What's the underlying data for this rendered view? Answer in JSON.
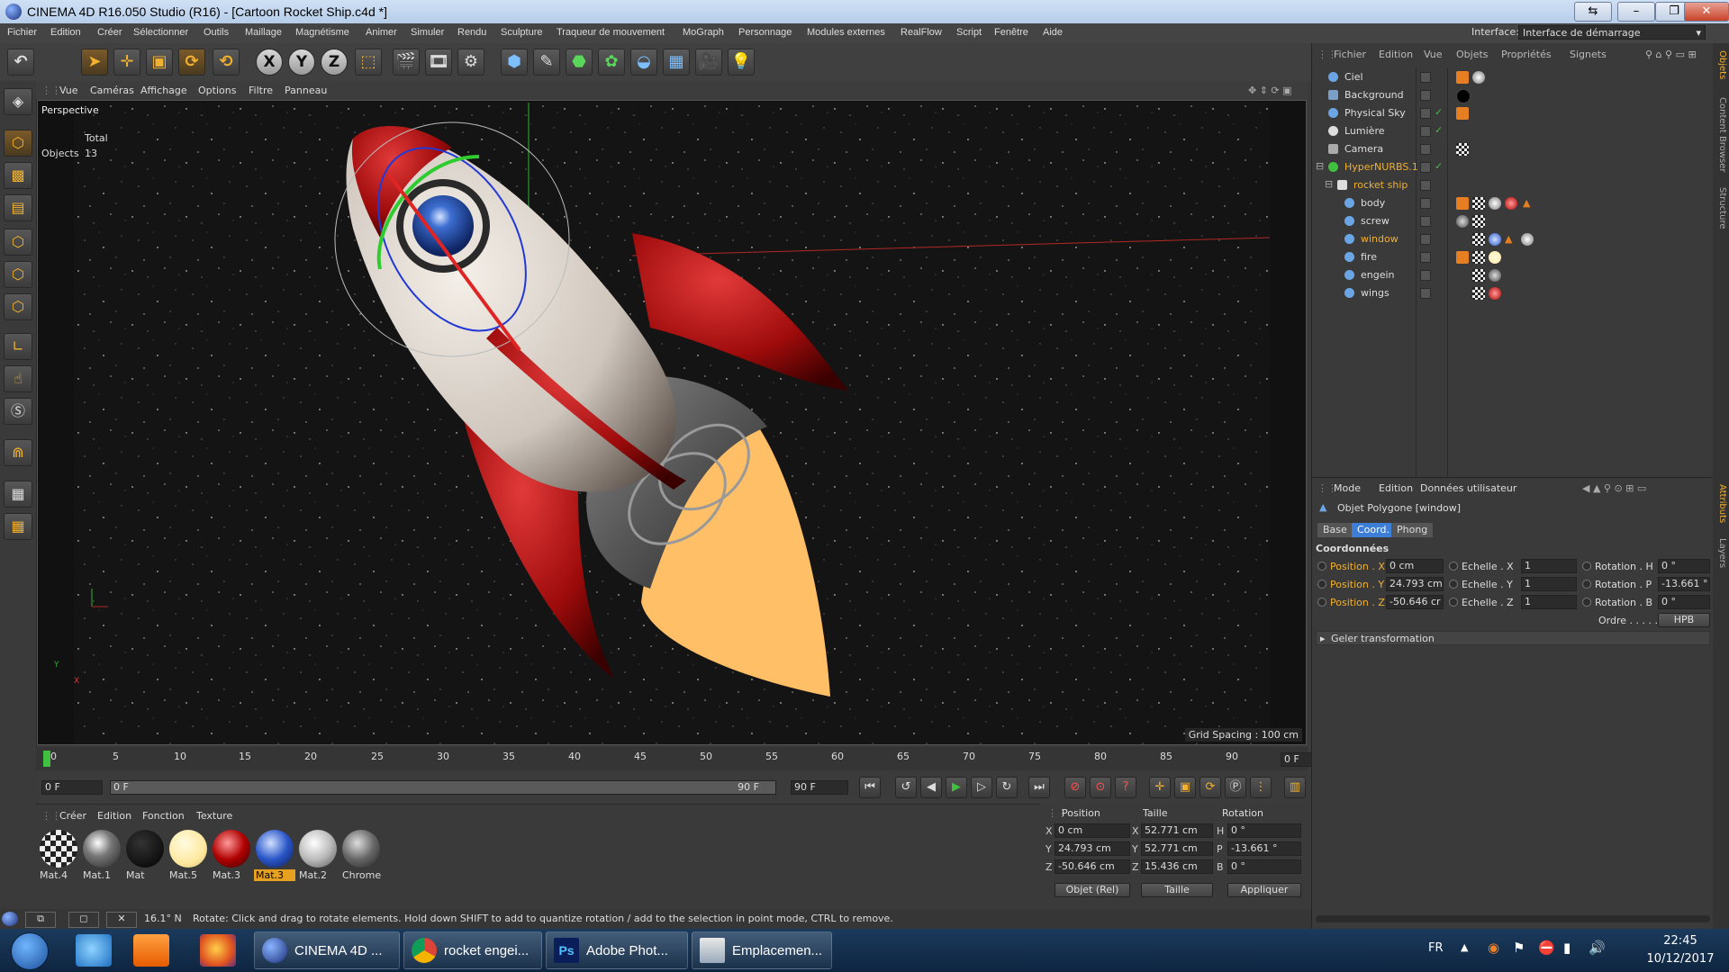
{
  "window": {
    "title": "CINEMA 4D R16.050 Studio (R16) - [Cartoon Rocket Ship.c4d *]"
  },
  "menu": [
    "Fichier",
    "Edition",
    "Créer",
    "Sélectionner",
    "Outils",
    "Maillage",
    "Magnétisme",
    "Animer",
    "Simuler",
    "Rendu",
    "Sculpture",
    "Traqueur de mouvement",
    "MoGraph",
    "Personnage",
    "Modules externes",
    "RealFlow",
    "Script",
    "Fenêtre",
    "Aide"
  ],
  "interface": {
    "label": "Interface:",
    "value": "Interface de démarrage"
  },
  "toolbar": {
    "x": "X",
    "y": "Y",
    "z": "Z"
  },
  "viewport": {
    "menu": [
      "Vue",
      "Caméras",
      "Affichage",
      "Options",
      "Filtre",
      "Panneau"
    ],
    "name": "Perspective",
    "total_label": "Total",
    "objects_label": "Objects",
    "objects_count": "13",
    "grid_spacing": "Grid Spacing : 100 cm",
    "axis_x": "X",
    "axis_y": "Y"
  },
  "timeline": {
    "ticks": [
      "0",
      "5",
      "10",
      "15",
      "20",
      "25",
      "30",
      "35",
      "40",
      "45",
      "50",
      "55",
      "60",
      "65",
      "70",
      "75",
      "80",
      "85",
      "90"
    ],
    "current_frame": "0 F",
    "start": "0 F",
    "range_start": "0 F",
    "range_end": "90 F",
    "end": "90 F"
  },
  "materials": {
    "menu": [
      "Créer",
      "Edition",
      "Fonction",
      "Texture"
    ],
    "items": [
      {
        "name": "Mat.4"
      },
      {
        "name": "Mat.1"
      },
      {
        "name": "Mat"
      },
      {
        "name": "Mat.5"
      },
      {
        "name": "Mat.3"
      },
      {
        "name": "Mat.3"
      },
      {
        "name": "Mat.2"
      },
      {
        "name": "Chrome"
      }
    ]
  },
  "coords": {
    "headers": [
      "Position",
      "Taille",
      "Rotation"
    ],
    "rows": [
      {
        "axis": "X",
        "pos": "0 cm",
        "size_axis": "X",
        "size": "52.771 cm",
        "rot_axis": "H",
        "rot": "0 °"
      },
      {
        "axis": "Y",
        "pos": "24.793 cm",
        "size_axis": "Y",
        "size": "52.771 cm",
        "rot_axis": "P",
        "rot": "-13.661 °"
      },
      {
        "axis": "Z",
        "pos": "-50.646 cm",
        "size_axis": "Z",
        "size": "15.436 cm",
        "rot_axis": "B",
        "rot": "0 °"
      }
    ],
    "mode": "Objet (Rel)",
    "size_mode": "Taille",
    "apply": "Appliquer"
  },
  "status": {
    "value": "16.1° N",
    "text": "Rotate: Click and drag to rotate elements. Hold down SHIFT to add to quantize rotation / add to the selection in point mode, CTRL to remove."
  },
  "object_manager": {
    "menu": [
      "Fichier",
      "Edition",
      "Vue",
      "Objets",
      "Propriétés",
      "Signets"
    ],
    "objects": [
      {
        "name": "Ciel",
        "level": 0
      },
      {
        "name": "Background",
        "level": 0
      },
      {
        "name": "Physical Sky",
        "level": 0
      },
      {
        "name": "Lumière",
        "level": 0
      },
      {
        "name": "Camera",
        "level": 0
      },
      {
        "name": "HyperNURBS.1",
        "level": 0
      },
      {
        "name": "rocket ship",
        "level": 1
      },
      {
        "name": "body",
        "level": 2
      },
      {
        "name": "screw",
        "level": 2
      },
      {
        "name": "window",
        "level": 2
      },
      {
        "name": "fire",
        "level": 2
      },
      {
        "name": "engein",
        "level": 2
      },
      {
        "name": "wings",
        "level": 2
      }
    ]
  },
  "attributes": {
    "menu": [
      "Mode",
      "Edition",
      "Données utilisateur"
    ],
    "object": "Objet Polygone [window]",
    "tabs": [
      "Base",
      "Coord.",
      "Phong"
    ],
    "section": "Coordonnées",
    "rows": [
      {
        "p_label": "Position . X",
        "p_val": "0 cm",
        "s_label": "Echelle . X",
        "s_val": "1",
        "r_label": "Rotation . H",
        "r_val": "0 °"
      },
      {
        "p_label": "Position . Y",
        "p_val": "24.793 cm",
        "s_label": "Echelle . Y",
        "s_val": "1",
        "r_label": "Rotation . P",
        "r_val": "-13.661 °"
      },
      {
        "p_label": "Position . Z",
        "p_val": "-50.646 cr",
        "s_label": "Echelle . Z",
        "s_val": "1",
        "r_label": "Rotation . B",
        "r_val": "0 °"
      }
    ],
    "order_label": "Ordre . . . . . .",
    "order_value": "HPB",
    "freeze": "Geler transformation"
  },
  "right_tabs": [
    "Objets",
    "Content Browser",
    "Structure",
    "Attributs",
    "Layers"
  ],
  "taskbar": {
    "tasks": [
      {
        "label": "CINEMA 4D ..."
      },
      {
        "label": "rocket engei..."
      },
      {
        "label": "Adobe Phot..."
      },
      {
        "label": "Emplacemen..."
      }
    ],
    "lang": "FR",
    "time": "22:45",
    "date": "10/12/2017"
  },
  "colors": {
    "accent": "#f0b030",
    "selection": "#3d7ed6",
    "rocket_red": "#9e0b0b",
    "flame": "#ffbf66"
  }
}
